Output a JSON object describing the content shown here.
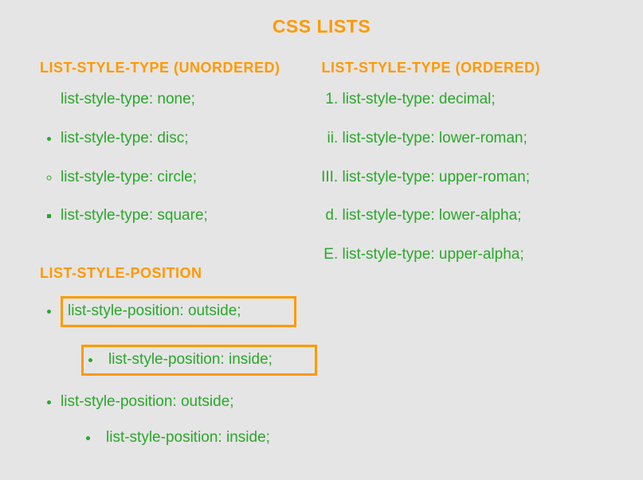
{
  "page_title": "CSS LISTS",
  "sections": {
    "unordered": {
      "title": "LIST-STYLE-TYPE (UNORDERED)",
      "items": [
        "list-style-type: none;",
        "list-style-type: disc;",
        "list-style-type: circle;",
        "list-style-type: square;"
      ]
    },
    "ordered": {
      "title": "LIST-STYLE-TYPE (ORDERED)",
      "items": [
        "list-style-type: decimal;",
        "list-style-type: lower-roman;",
        "list-style-type: upper-roman;",
        "list-style-type: lower-alpha;",
        "list-style-type: upper-alpha;"
      ]
    },
    "position": {
      "title": "LIST-STYLE-POSITION",
      "boxed": [
        "list-style-position: outside;",
        "list-style-position: inside;"
      ],
      "plain": [
        "list-style-position: outside;",
        "list-style-position: inside;"
      ]
    }
  }
}
